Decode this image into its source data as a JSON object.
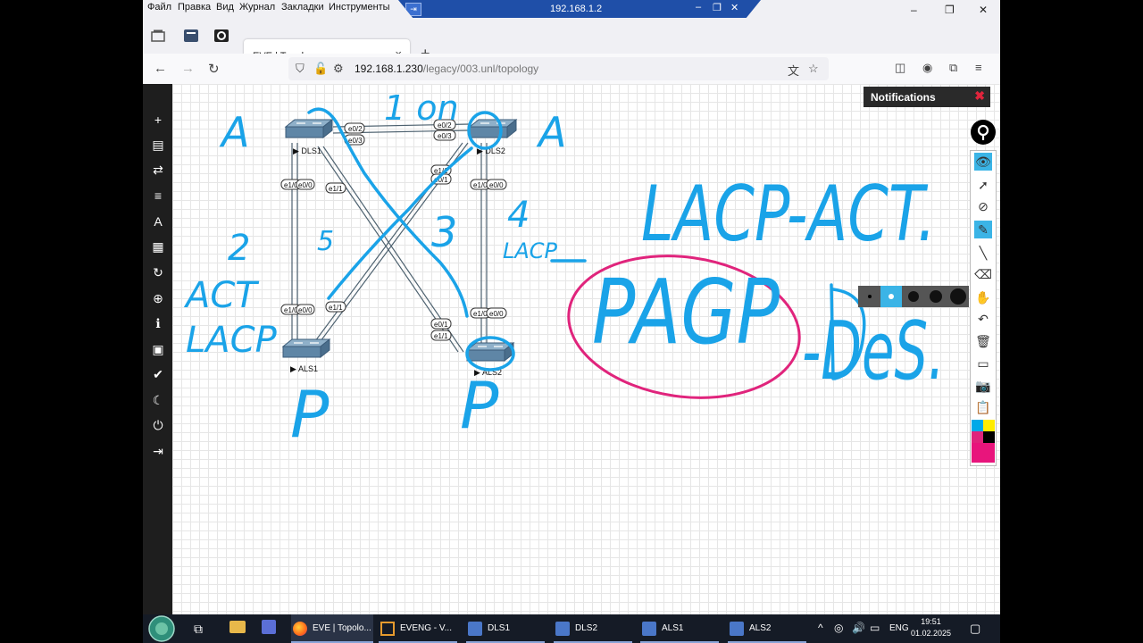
{
  "menubar": {
    "items": [
      "Файл",
      "Правка",
      "Вид",
      "Журнал",
      "Закладки",
      "Инструменты"
    ]
  },
  "vnc": {
    "title": "192.168.1.2"
  },
  "tab": {
    "title": "EVE | Topology"
  },
  "address": {
    "host": "192.168.1.230",
    "path": "/legacy/003.unl/topology"
  },
  "notifications": {
    "title": "Notifications"
  },
  "nodes": [
    {
      "label": "DLS1"
    },
    {
      "label": "DLS2"
    },
    {
      "label": "ALS1"
    },
    {
      "label": "ALS2"
    }
  ],
  "ports": {
    "dls1_a": "e0/2",
    "dls1_b": "e0/3",
    "dls2_a": "e0/2",
    "dls2_b": "e0/3",
    "dls1_l1": "e1/0",
    "dls1_l2": "e0/0",
    "dls1_x": "e1/1",
    "dls2_x1": "e1/1",
    "dls2_x2": "e0/1",
    "dls2_l1": "e1/0",
    "dls2_l2": "e0/0",
    "als1_l1": "e1/0",
    "als1_l2": "e0/0",
    "als1_x": "e1/1",
    "als2_l1": "e1/0",
    "als2_l2": "e0/0",
    "als2_x1": "e0/1",
    "als2_x2": "e1/1"
  },
  "annotations": {
    "a_left": "A",
    "a_right": "A",
    "one_on": "1 on",
    "two": "2",
    "act": "ACT",
    "lacp": "LACP",
    "three": "3",
    "four": "4",
    "lacp2": "LACP",
    "five": "5",
    "p_left": "P",
    "p_right": "P",
    "lacp_act": "LACP-ACT.",
    "pagp": "PAGP",
    "des": "-DeS."
  },
  "colors": {
    "ink": "#1aa3e8",
    "pagp_circle": "#e0247c",
    "accent": "#3bb4e6"
  },
  "taskbar": {
    "items": [
      {
        "label": "EVE | Topolo..."
      },
      {
        "label": "EVENG - V..."
      },
      {
        "label": "DLS1"
      },
      {
        "label": "DLS2"
      },
      {
        "label": "ALS1"
      },
      {
        "label": "ALS2"
      }
    ],
    "lang": "ENG",
    "time": "19:51",
    "date": "01.02.2025"
  }
}
